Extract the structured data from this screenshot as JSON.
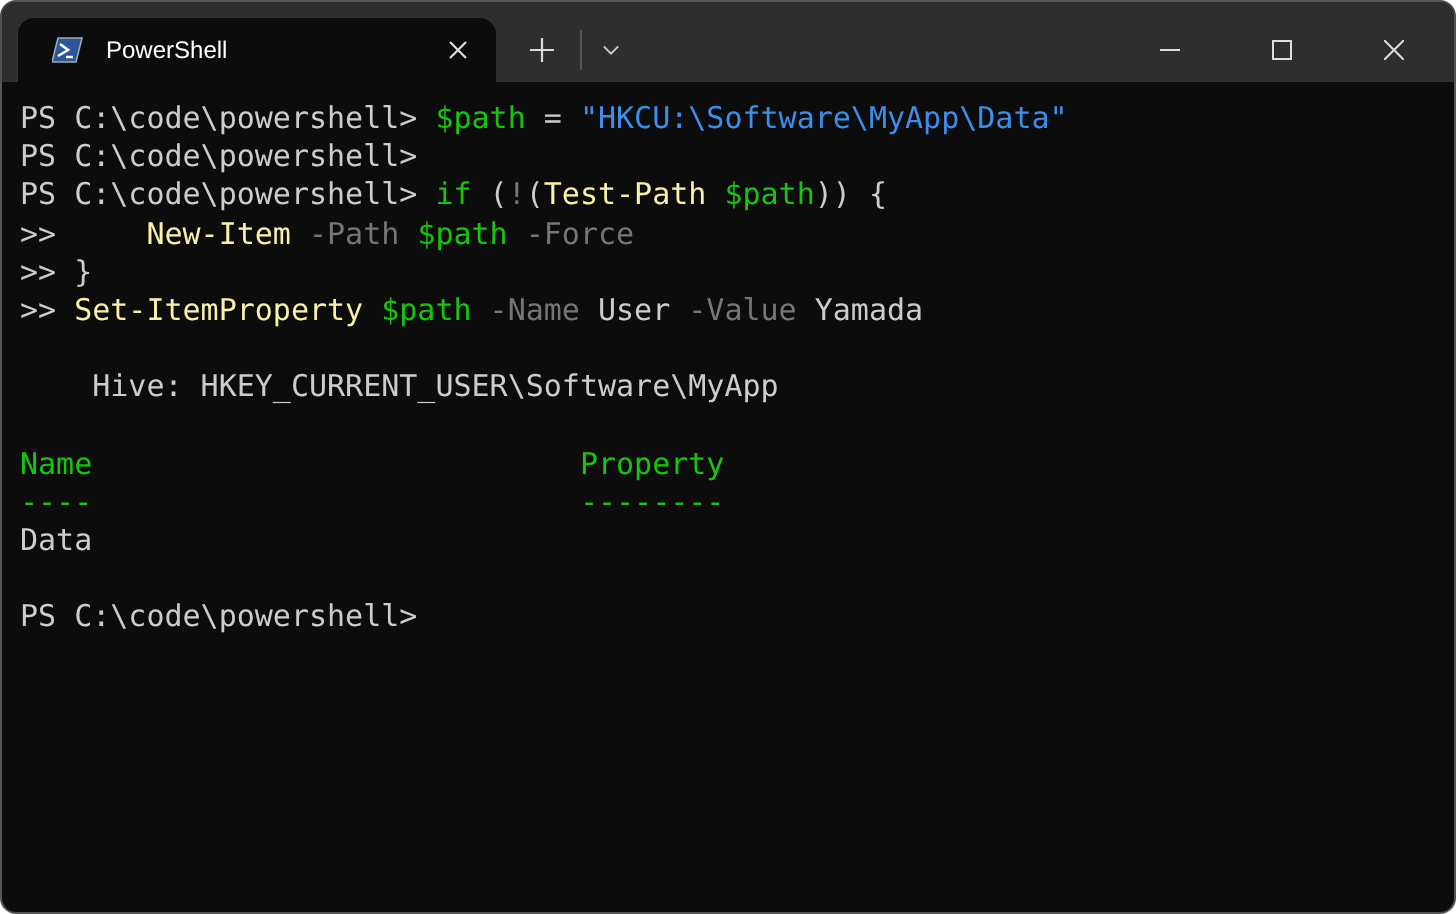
{
  "tabs": [
    {
      "title": "PowerShell",
      "selected": true
    }
  ],
  "terminal": {
    "lines": [
      {
        "kind": "text",
        "segments": [
          {
            "kind": "prompt",
            "text": "PS C:\\code\\powershell> "
          },
          {
            "kind": "variable",
            "text": "$path"
          },
          {
            "kind": "plain",
            "text": " = "
          },
          {
            "kind": "string",
            "text": "\"HKCU:\\Software\\MyApp\\Data\""
          }
        ]
      },
      {
        "kind": "text",
        "segments": [
          {
            "kind": "prompt",
            "text": "PS C:\\code\\powershell>"
          }
        ]
      },
      {
        "kind": "text",
        "segments": [
          {
            "kind": "prompt",
            "text": "PS C:\\code\\powershell> "
          },
          {
            "kind": "variable",
            "text": "if"
          },
          {
            "kind": "plain",
            "text": " ("
          },
          {
            "kind": "operator",
            "text": "!"
          },
          {
            "kind": "plain",
            "text": "("
          },
          {
            "kind": "command",
            "text": "Test-Path "
          },
          {
            "kind": "variable",
            "text": "$path"
          },
          {
            "kind": "plain",
            "text": ")) {"
          }
        ]
      },
      {
        "kind": "text",
        "segments": [
          {
            "kind": "prompt",
            "text": ">>     "
          },
          {
            "kind": "command",
            "text": "New-Item"
          },
          {
            "kind": "parameter",
            "text": " -Path "
          },
          {
            "kind": "variable",
            "text": "$path"
          },
          {
            "kind": "parameter",
            "text": " -Force"
          }
        ]
      },
      {
        "kind": "text",
        "segments": [
          {
            "kind": "prompt",
            "text": ">> "
          },
          {
            "kind": "plain",
            "text": "}"
          }
        ]
      },
      {
        "kind": "text",
        "segments": [
          {
            "kind": "prompt",
            "text": ">> "
          },
          {
            "kind": "command",
            "text": "Set-ItemProperty "
          },
          {
            "kind": "variable",
            "text": "$path"
          },
          {
            "kind": "parameter",
            "text": " -Name "
          },
          {
            "kind": "plain",
            "text": "User"
          },
          {
            "kind": "parameter",
            "text": " -Value "
          },
          {
            "kind": "plain",
            "text": "Yamada"
          }
        ]
      },
      {
        "kind": "blank"
      },
      {
        "kind": "text",
        "segments": [
          {
            "kind": "plain",
            "text": "    Hive: HKEY_CURRENT_USER\\Software\\MyApp"
          }
        ]
      },
      {
        "kind": "blank"
      },
      {
        "kind": "text",
        "segments": [
          {
            "kind": "header",
            "text": "Name                           Property"
          }
        ]
      },
      {
        "kind": "text",
        "segments": [
          {
            "kind": "header",
            "text": "----                           --------"
          }
        ]
      },
      {
        "kind": "text",
        "segments": [
          {
            "kind": "plain",
            "text": "Data"
          }
        ]
      },
      {
        "kind": "blank"
      },
      {
        "kind": "text",
        "segments": [
          {
            "kind": "prompt",
            "text": "PS C:\\code\\powershell>"
          }
        ]
      }
    ]
  }
}
